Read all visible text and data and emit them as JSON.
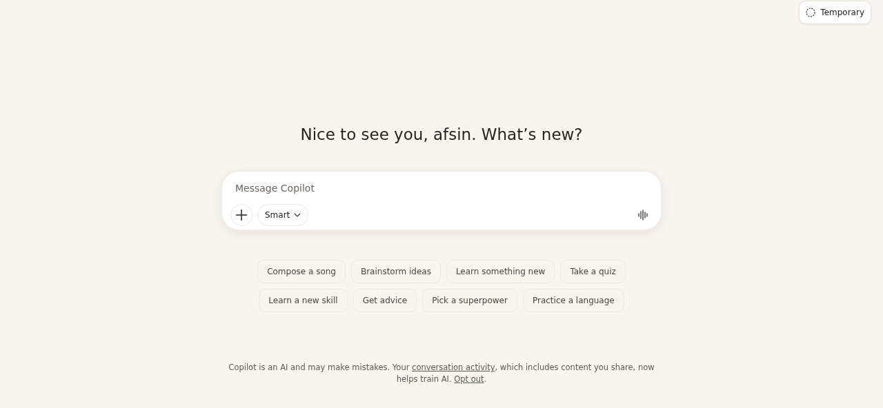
{
  "temporary_button": {
    "label": "Temporary"
  },
  "greeting": "Nice to see you, afsin. What’s new?",
  "composer": {
    "placeholder": "Message Copilot",
    "mode": "Smart"
  },
  "suggestions": [
    [
      "Compose a song",
      "Brainstorm ideas",
      "Learn something new",
      "Take a quiz"
    ],
    [
      "Learn a new skill",
      "Get advice",
      "Pick a superpower",
      "Practice a language"
    ]
  ],
  "disclaimer": [
    {
      "kind": "text",
      "text": "Copilot is an AI and may make mistakes. Your "
    },
    {
      "kind": "link",
      "text": "conversation activity"
    },
    {
      "kind": "text",
      "text": ", which includes content you share, now helps train AI. "
    },
    {
      "kind": "link",
      "text": "Opt out"
    },
    {
      "kind": "text",
      "text": "."
    }
  ]
}
